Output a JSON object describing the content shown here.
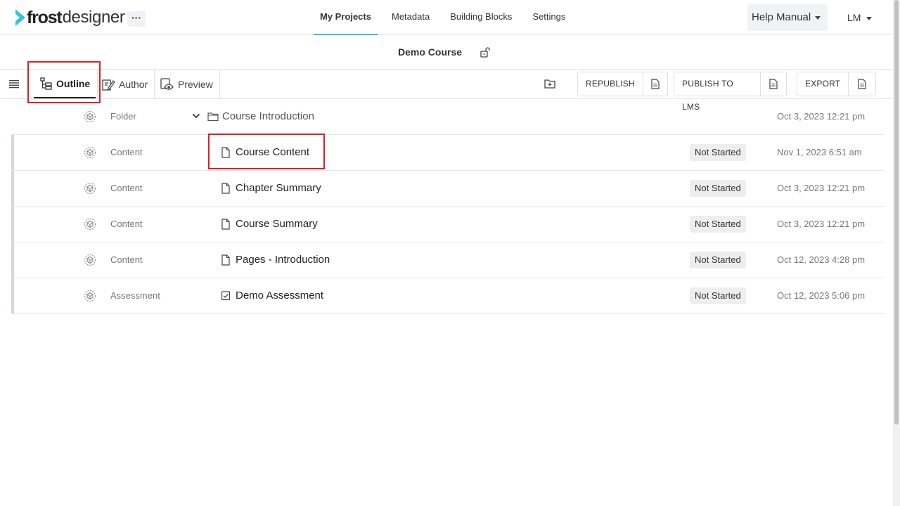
{
  "app": {
    "logo_bold": "frost",
    "logo_light": "designer",
    "more_label": "···"
  },
  "nav": {
    "items": [
      {
        "label": "My Projects",
        "active": true
      },
      {
        "label": "Metadata",
        "active": false
      },
      {
        "label": "Building Blocks",
        "active": false
      },
      {
        "label": "Settings",
        "active": false
      }
    ],
    "help_label": "Help Manual",
    "user_initials": "LM"
  },
  "course": {
    "title": "Demo Course"
  },
  "toolbar": {
    "tabs": [
      {
        "label": "Outline",
        "active": true
      },
      {
        "label": "Author",
        "active": false
      },
      {
        "label": "Preview",
        "active": false
      }
    ],
    "republish_label": "REPUBLISH",
    "publish_lms_label": "PUBLISH TO LMS",
    "export_label": "EXPORT"
  },
  "rows": [
    {
      "type": "Folder",
      "name": "Course Introduction",
      "icon": "folder-icon",
      "status": "",
      "date": "Oct 3, 2023 12:21 pm"
    },
    {
      "type": "Content",
      "name": "Course Content",
      "icon": "document-icon",
      "status": "Not Started",
      "date": "Nov 1, 2023 6:51 am"
    },
    {
      "type": "Content",
      "name": "Chapter Summary",
      "icon": "document-icon",
      "status": "Not Started",
      "date": "Oct 3, 2023 12:21 pm"
    },
    {
      "type": "Content",
      "name": "Course Summary",
      "icon": "document-icon",
      "status": "Not Started",
      "date": "Oct 3, 2023 12:21 pm"
    },
    {
      "type": "Content",
      "name": "Pages - Introduction",
      "icon": "document-icon",
      "status": "Not Started",
      "date": "Oct 12, 2023 4:28 pm"
    },
    {
      "type": "Assessment",
      "name": "Demo Assessment",
      "icon": "checkbox-icon",
      "status": "Not Started",
      "date": "Oct 12, 2023 5:06 pm"
    }
  ],
  "colors": {
    "accent": "#33c6d8",
    "highlight": "#d92027",
    "row_bar": "#cfdadd",
    "badge_bg": "#eeeeee"
  }
}
